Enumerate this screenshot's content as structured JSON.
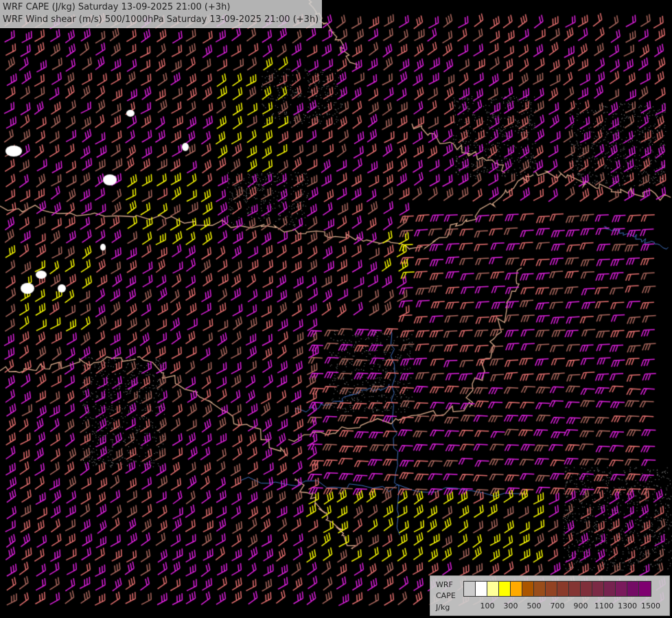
{
  "title": {
    "line1": "WRF CAPE (J/kg) Saturday 13-09-2025 21:00 (+3h)",
    "line2": "WRF Wind shear (m/s) 500/1000hPa Saturday 13-09-2025 21:00 (+3h)"
  },
  "legend": {
    "model": "WRF",
    "field": "CAPE",
    "unit": "J/kg",
    "colors": [
      "#cccccc",
      "#ffffff",
      "#ffff99",
      "#ffff00",
      "#ffaa00",
      "#aa5500",
      "#994d1a",
      "#924223",
      "#8a3a2a",
      "#843533",
      "#7f2f3a",
      "#7b2a45",
      "#76234f",
      "#7a1a5c",
      "#740c65",
      "#7f0070"
    ],
    "ticks": [
      "100",
      "300",
      "500",
      "700",
      "900",
      "1100",
      "1300",
      "1500"
    ]
  },
  "map_colors": {
    "barb_magenta": "#e020e0",
    "barb_salmon": "#e87070",
    "barb_brown": "#b06a60",
    "barb_yellow": "#ffff00",
    "border": "#e0b090",
    "river": "#4070c0",
    "terrain": "#999999"
  }
}
